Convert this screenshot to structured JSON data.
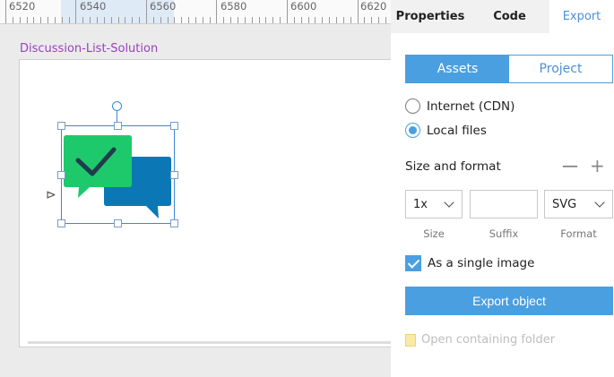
{
  "ruler": {
    "labels": [
      "6520",
      "6540",
      "6560",
      "6580",
      "6600",
      "6620"
    ]
  },
  "artboard": {
    "title": "Discussion-List-Solution"
  },
  "logo": {
    "front_color": "#1ec96b",
    "back_color": "#0b78b5",
    "check_color": "#1f3b4d"
  },
  "panel": {
    "tabs": {
      "properties": "Properties",
      "code": "Code",
      "export": "Export"
    },
    "segment": {
      "assets": "Assets",
      "project": "Project"
    },
    "radios": {
      "cdn": "Internet (CDN)",
      "local": "Local files"
    },
    "size_and_format": {
      "title": "Size and format",
      "minus": "—",
      "plus": "+"
    },
    "fields": {
      "size_value": "1x",
      "suffix_value": "",
      "format_value": "SVG",
      "size_caption": "Size",
      "suffix_caption": "Suffix",
      "format_caption": "Format"
    },
    "single_image_label": "As a single image",
    "export_button": "Export object",
    "open_folder": "Open containing folder",
    "accent_color": "#4a9fe0"
  }
}
